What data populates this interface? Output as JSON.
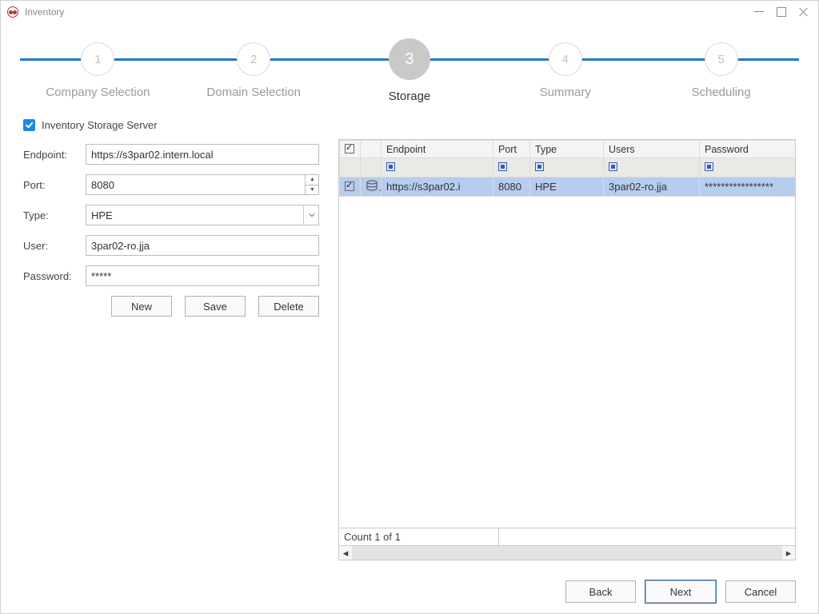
{
  "window": {
    "title": "Inventory"
  },
  "steps": [
    {
      "num": "1",
      "label": "Company Selection",
      "active": false
    },
    {
      "num": "2",
      "label": "Domain Selection",
      "active": false
    },
    {
      "num": "3",
      "label": "Storage",
      "active": true
    },
    {
      "num": "4",
      "label": "Summary",
      "active": false
    },
    {
      "num": "5",
      "label": "Scheduling",
      "active": false
    }
  ],
  "checkbox": {
    "label": "Inventory Storage Server",
    "checked": true
  },
  "form": {
    "endpoint_label": "Endpoint:",
    "endpoint_value": "https://s3par02.intern.local",
    "port_label": "Port:",
    "port_value": "8080",
    "type_label": "Type:",
    "type_value": "HPE",
    "user_label": "User:",
    "user_value": "3par02-ro.jja",
    "password_label": "Password:",
    "password_value": "*****"
  },
  "buttons": {
    "new": "New",
    "save": "Save",
    "delete": "Delete"
  },
  "grid": {
    "headers": {
      "endpoint": "Endpoint",
      "port": "Port",
      "type": "Type",
      "users": "Users",
      "password": "Password"
    },
    "rows": [
      {
        "checked": true,
        "endpoint": "https://s3par02.i",
        "port": "8080",
        "type": "HPE",
        "users": "3par02-ro.jja",
        "password": "*****************"
      }
    ],
    "count": "Count 1 of 1"
  },
  "footer": {
    "back": "Back",
    "next": "Next",
    "cancel": "Cancel"
  }
}
